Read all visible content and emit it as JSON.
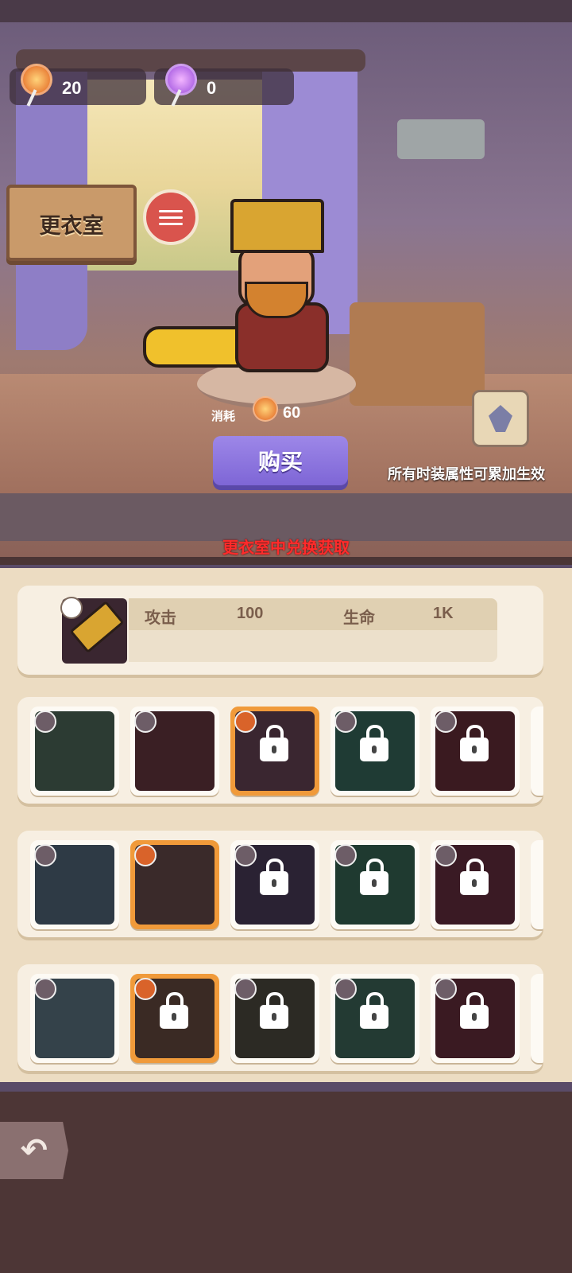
{
  "resources": [
    {
      "icon": "lollipop-orange-icon",
      "value": "20"
    },
    {
      "icon": "lollipop-pink-icon",
      "value": "0"
    }
  ],
  "sign": {
    "title": "更衣室"
  },
  "filter": {
    "icon": "sliders-icon"
  },
  "cost": {
    "label": "消耗",
    "icon": "lollipop-orange-icon",
    "value": "60"
  },
  "buy_button": {
    "label": "购买"
  },
  "badge": {
    "icon": "trident-badge-icon"
  },
  "note": "所有时装属性可累加生效",
  "exchange_text": "更衣室中兑换获取",
  "info": {
    "stats": [
      {
        "label": "攻击",
        "value": "100"
      },
      {
        "label": "生命",
        "value": "1K"
      }
    ]
  },
  "rows": [
    {
      "category": "weapon",
      "items": [
        {
          "name": "trident",
          "locked": false,
          "selected": false,
          "color": "#2c3b33"
        },
        {
          "name": "broken-sword",
          "locked": false,
          "selected": false,
          "color": "#3a1f24"
        },
        {
          "name": "golden-blade",
          "locked": true,
          "selected": true,
          "color": "#3a2630"
        },
        {
          "name": "spiked-mace",
          "locked": true,
          "selected": false,
          "color": "#1f3b34"
        },
        {
          "name": "flame-sword",
          "locked": true,
          "selected": false,
          "color": "#3a1a20"
        }
      ]
    },
    {
      "category": "outfit",
      "items": [
        {
          "name": "blue-jacket",
          "locked": false,
          "selected": false,
          "color": "#2e3a45"
        },
        {
          "name": "red-vest",
          "locked": false,
          "selected": true,
          "color": "#3a2a2a"
        },
        {
          "name": "dark-robe",
          "locked": true,
          "selected": false,
          "color": "#2a2233"
        },
        {
          "name": "green-armor",
          "locked": true,
          "selected": false,
          "color": "#1f3a30"
        },
        {
          "name": "red-coat",
          "locked": true,
          "selected": false,
          "color": "#3a1a24"
        }
      ]
    },
    {
      "category": "head",
      "items": [
        {
          "name": "curly-hair",
          "locked": false,
          "selected": false,
          "color": "#34424a"
        },
        {
          "name": "gold-helm",
          "locked": true,
          "selected": true,
          "color": "#3a2a24"
        },
        {
          "name": "feather-mask",
          "locked": true,
          "selected": false,
          "color": "#2c2a24"
        },
        {
          "name": "green-hat",
          "locked": true,
          "selected": false,
          "color": "#233a33"
        },
        {
          "name": "horned-hood",
          "locked": true,
          "selected": false,
          "color": "#3a1a22"
        }
      ]
    }
  ]
}
